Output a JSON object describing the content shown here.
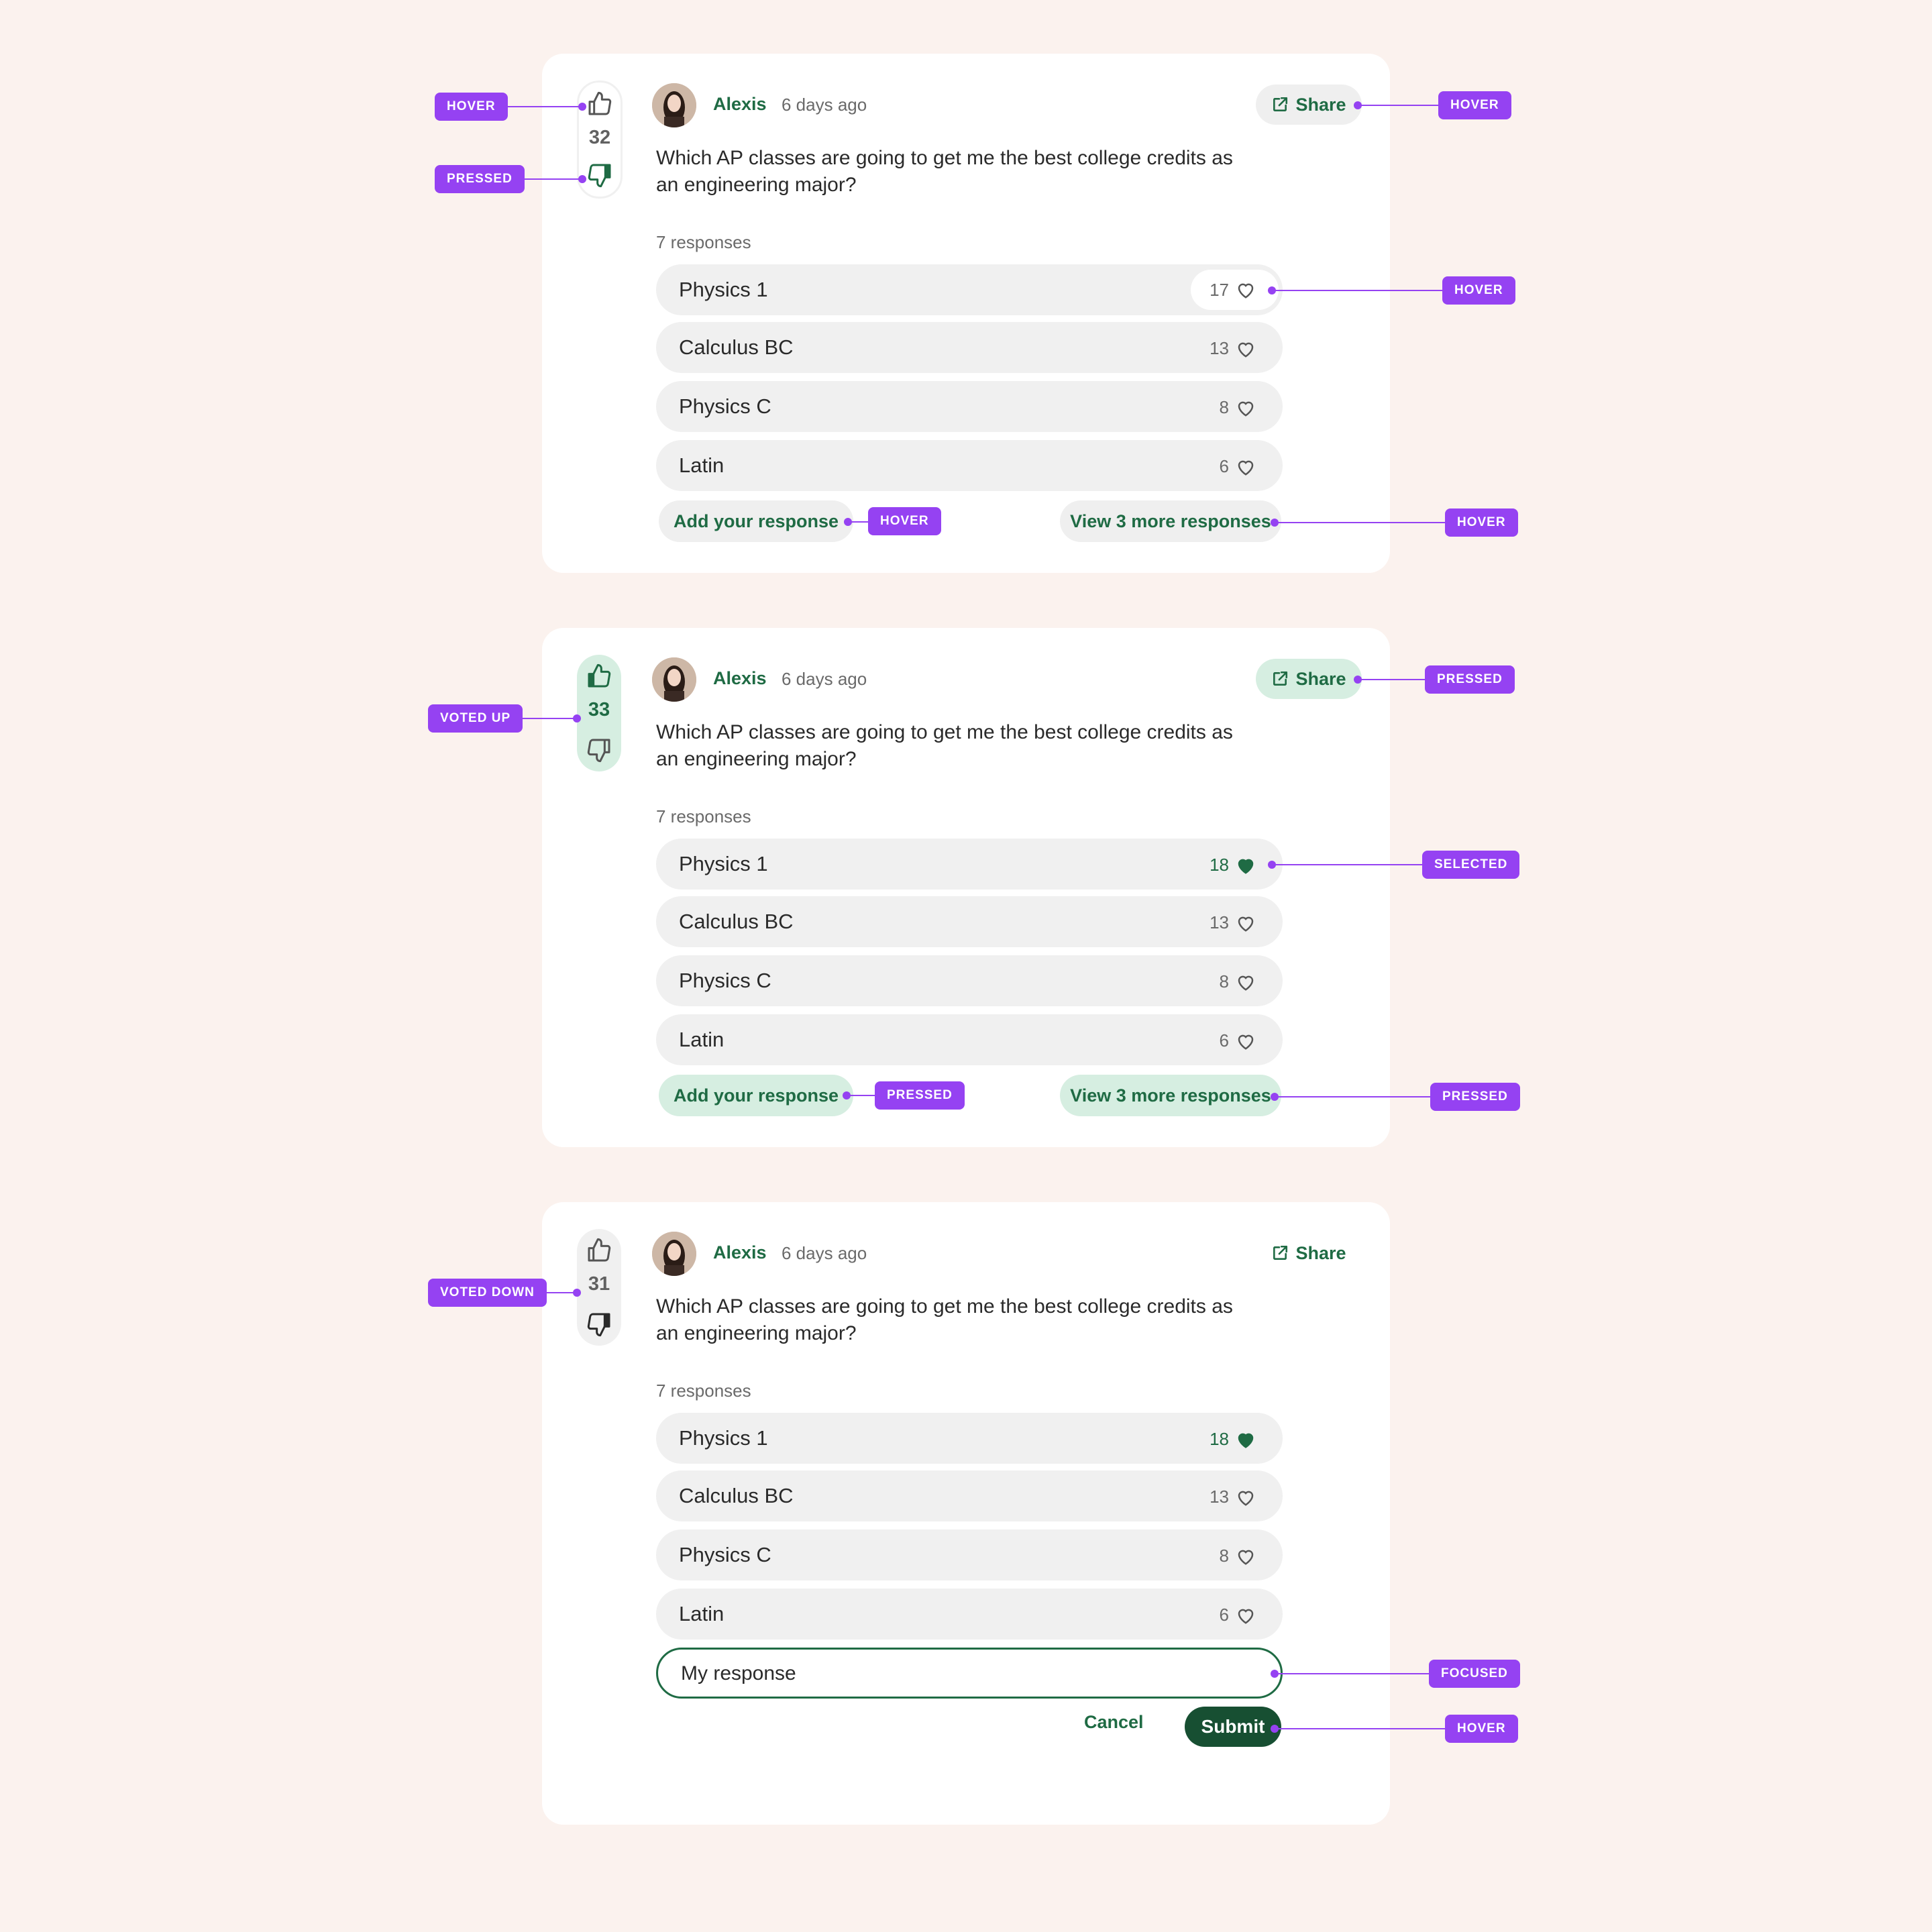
{
  "colors": {
    "background": "#fbf2ee",
    "brand_green": "#1f6b44",
    "dark_green": "#174f32",
    "pressed_green": "#d6eee1",
    "annotation_purple": "#9542f2",
    "row_gray": "#f0f0f0"
  },
  "icons": {
    "upvote": "thumbs-up-icon",
    "downvote": "thumbs-down-icon",
    "share": "external-link-icon",
    "like": "heart-icon"
  },
  "cards": [
    {
      "votes": "32",
      "author": "Alexis",
      "time": "6 days ago",
      "share_label": "Share",
      "question": "Which AP classes are going to get me the best college credits as an engineering major?",
      "responses_count": "7 responses",
      "responses": [
        {
          "label": "Physics 1",
          "likes": "17"
        },
        {
          "label": "Calculus BC",
          "likes": "13"
        },
        {
          "label": "Physics C",
          "likes": "8"
        },
        {
          "label": "Latin",
          "likes": "6"
        }
      ],
      "add_label": "Add your response",
      "more_label": "View 3 more responses"
    },
    {
      "votes": "33",
      "author": "Alexis",
      "time": "6 days ago",
      "share_label": "Share",
      "question": "Which AP classes are going to get me the best college credits as an engineering major?",
      "responses_count": "7 responses",
      "responses": [
        {
          "label": "Physics 1",
          "likes": "18"
        },
        {
          "label": "Calculus BC",
          "likes": "13"
        },
        {
          "label": "Physics C",
          "likes": "8"
        },
        {
          "label": "Latin",
          "likes": "6"
        }
      ],
      "add_label": "Add your response",
      "more_label": "View 3 more responses"
    },
    {
      "votes": "31",
      "author": "Alexis",
      "time": "6 days ago",
      "share_label": "Share",
      "question": "Which AP classes are going to get me the best college credits as an engineering major?",
      "responses_count": "7 responses",
      "responses": [
        {
          "label": "Physics 1",
          "likes": "18"
        },
        {
          "label": "Calculus BC",
          "likes": "13"
        },
        {
          "label": "Physics C",
          "likes": "8"
        },
        {
          "label": "Latin",
          "likes": "6"
        }
      ],
      "input_value": "My response",
      "cancel_label": "Cancel",
      "submit_label": "Submit"
    }
  ],
  "annotations": {
    "hover": "HOVER",
    "pressed": "PRESSED",
    "voted_up": "VOTED UP",
    "voted_down": "VOTED DOWN",
    "selected": "SELECTED",
    "focused": "FOCUSED"
  }
}
